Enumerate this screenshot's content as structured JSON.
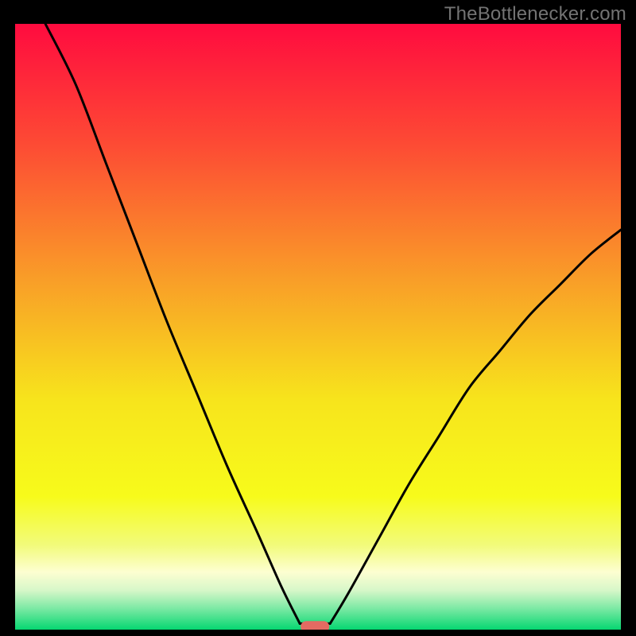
{
  "watermark": "TheBottlenecker.com",
  "chart_data": {
    "type": "line",
    "title": "",
    "xlabel": "",
    "ylabel": "",
    "xlim": [
      0,
      100
    ],
    "ylim": [
      0,
      100
    ],
    "series": [
      {
        "name": "left-curve",
        "x": [
          5,
          10,
          15,
          20,
          25,
          30,
          35,
          40,
          44,
          47
        ],
        "values": [
          100,
          90,
          77,
          64,
          51,
          39,
          27,
          16,
          7,
          1
        ]
      },
      {
        "name": "right-curve",
        "x": [
          52,
          55,
          60,
          65,
          70,
          75,
          80,
          85,
          90,
          95,
          100
        ],
        "values": [
          1,
          6,
          15,
          24,
          32,
          40,
          46,
          52,
          57,
          62,
          66
        ]
      }
    ],
    "marker": {
      "x": 49.5,
      "y": 0.5
    },
    "gradient_stops": [
      {
        "offset": 0.0,
        "color": "#ff0b3f"
      },
      {
        "offset": 0.2,
        "color": "#fd4b34"
      },
      {
        "offset": 0.42,
        "color": "#f99d28"
      },
      {
        "offset": 0.62,
        "color": "#f7e41c"
      },
      {
        "offset": 0.78,
        "color": "#f7fb1b"
      },
      {
        "offset": 0.86,
        "color": "#f2fb7a"
      },
      {
        "offset": 0.905,
        "color": "#fdfed1"
      },
      {
        "offset": 0.935,
        "color": "#d7f7c9"
      },
      {
        "offset": 0.965,
        "color": "#7ce9a4"
      },
      {
        "offset": 1.0,
        "color": "#06d771"
      }
    ]
  }
}
